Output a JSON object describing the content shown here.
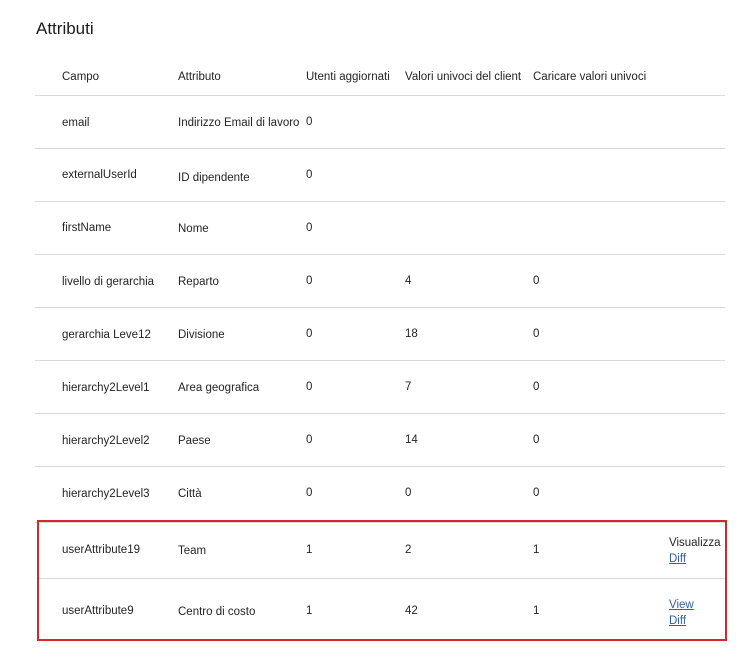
{
  "page_title": "Attributi",
  "columns": [
    "Campo",
    "Attributo",
    "Utenti aggiornati",
    "Valori univoci del client",
    "Caricare valori univoci"
  ],
  "rows": [
    {
      "campo": "email",
      "attributo": "Indirizzo Email di lavoro",
      "utenti": "0",
      "valori_client": "",
      "caricare": ""
    },
    {
      "campo": "externalUserId",
      "attributo": "ID dipendente",
      "utenti": "0",
      "valori_client": "",
      "caricare": ""
    },
    {
      "campo": "firstName",
      "attributo": "Nome",
      "utenti": "0",
      "valori_client": "",
      "caricare": ""
    },
    {
      "campo": "livello di gerarchia",
      "attributo": "Reparto",
      "utenti": "0",
      "valori_client": "4",
      "caricare": "0"
    },
    {
      "campo": "gerarchia Leve12",
      "attributo": "Divisione",
      "utenti": "0",
      "valori_client": "18",
      "caricare": "0"
    },
    {
      "campo": "hierarchy2Level1",
      "attributo": "Area geografica",
      "utenti": "0",
      "valori_client": "7",
      "caricare": "0"
    },
    {
      "campo": "hierarchy2Level2",
      "attributo": "Paese",
      "utenti": "0",
      "valori_client": "14",
      "caricare": "0"
    },
    {
      "campo": "hierarchy2Level3",
      "attributo": "Città",
      "utenti": "0",
      "valori_client": "0",
      "caricare": "0"
    }
  ],
  "highlighted_rows": [
    {
      "campo": "userAttribute19",
      "attributo": "Team",
      "utenti": "1",
      "valori_client": "2",
      "caricare": "1",
      "action_line1": "Visualizza",
      "action_line2": "Diff"
    },
    {
      "campo": "userAttribute9",
      "attributo": "Centro di costo",
      "utenti": "1",
      "valori_client": "42",
      "caricare": "1",
      "action_line1": "View",
      "action_line2": "Diff"
    }
  ],
  "highlight_color": "#d7272a",
  "link_color": "#2f5fa8"
}
